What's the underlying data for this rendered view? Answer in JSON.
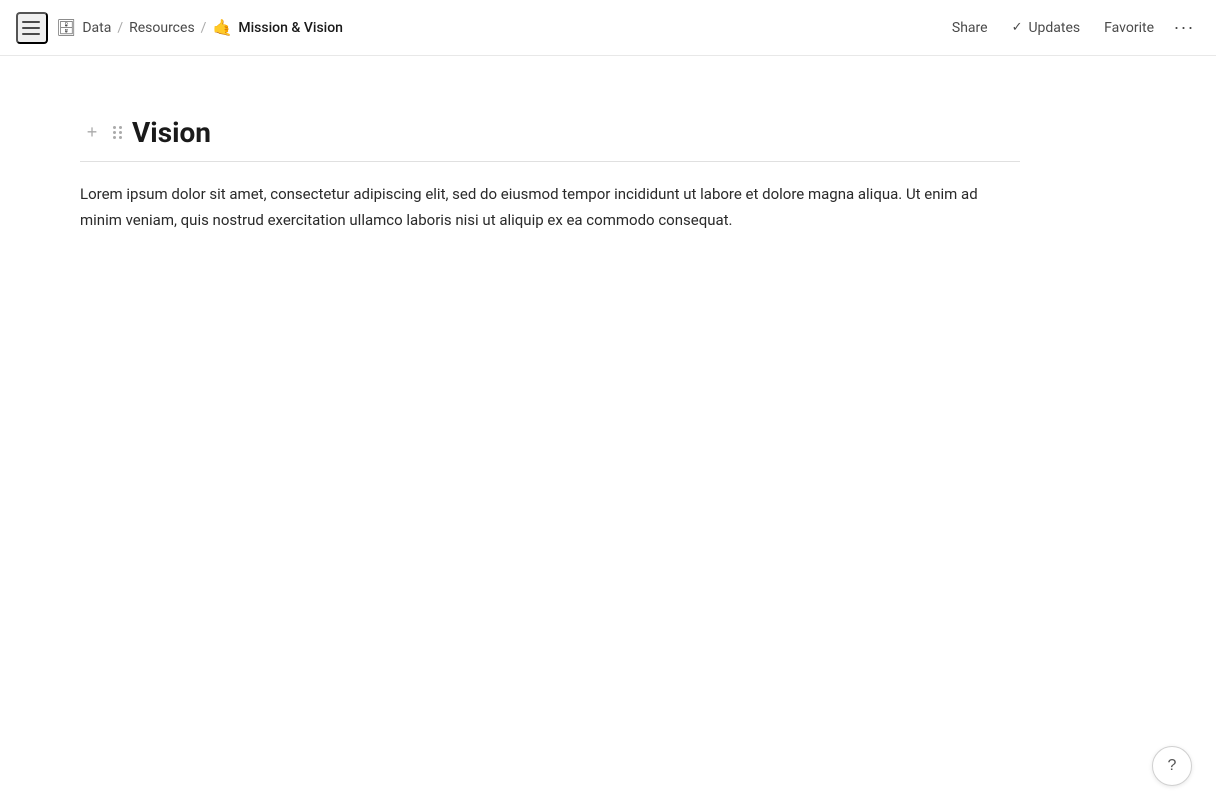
{
  "header": {
    "menu_icon_label": "Menu",
    "breadcrumb": {
      "root_icon": "🗄",
      "root_label": "Data",
      "sep1": "/",
      "mid_label": "Resources",
      "sep2": "/",
      "current_icon": "🤙",
      "current_label": "Mission & Vision"
    },
    "actions": {
      "share_label": "Share",
      "updates_label": "Updates",
      "favorite_label": "Favorite",
      "more_label": "···"
    }
  },
  "content": {
    "section_title": "Vision",
    "body_text": "Lorem ipsum dolor sit amet, consectetur adipiscing elit, sed do eiusmod tempor incididunt ut labore et dolore magna aliqua. Ut enim ad minim veniam, quis nostrud exercitation ullamco laboris nisi ut aliquip ex ea commodo consequat."
  },
  "help": {
    "label": "?"
  }
}
